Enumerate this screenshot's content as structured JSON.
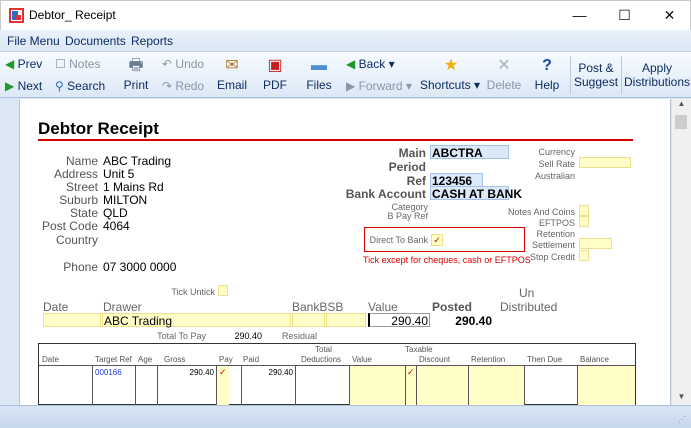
{
  "window": {
    "title": "Debtor_ Receipt",
    "controls": {
      "minimize": "—",
      "maximize": "☐",
      "close": "✕"
    }
  },
  "menu": [
    "File Menu",
    "Documents",
    "Reports"
  ],
  "toolbar": {
    "prev": "Prev",
    "next": "Next",
    "notes": "Notes",
    "search": "Search",
    "print": "Print",
    "undo": "Undo",
    "redo": "Redo",
    "email": "Email",
    "pdf": "PDF",
    "files": "Files",
    "back": "Back",
    "forward": "Forward",
    "shortcuts": "Shortcuts",
    "delete": "Delete",
    "help": "Help",
    "post_suggest_1": "Post &",
    "post_suggest_2": "Suggest",
    "apply_dist_1": "Apply",
    "apply_dist_2": "Distributions",
    "icons": {
      "prev": "green-left-arrow",
      "next": "green-right-arrow",
      "search": "magnifier",
      "print": "printer",
      "email": "envelope",
      "pdf": "pdf",
      "files": "folder",
      "back": "green-left-arrow",
      "shortcuts": "star",
      "delete": "x",
      "help": "question-mark"
    }
  },
  "form": {
    "heading": "Debtor Receipt",
    "customer": {
      "name_label": "Name",
      "name": "ABC Trading",
      "address_label": "Address",
      "address": "Unit 5",
      "street_label": "Street",
      "street": "1 Mains Rd",
      "suburb_label": "Suburb",
      "suburb": "MILTON",
      "state_label": "State",
      "state": "QLD",
      "postcode_label": "Post Code",
      "postcode": "4064",
      "country_label": "Country",
      "country": "",
      "phone_label": "Phone",
      "phone": "07 3000 0000"
    },
    "account": {
      "main_label": "Main",
      "main": "ABCTRA",
      "period_label": "Period",
      "period": "",
      "ref_label": "Ref",
      "ref": "123456",
      "bank_label": "Bank Account",
      "bank": "CASH AT BANK",
      "category_label": "Category",
      "bpay_label": "B Pay Ref",
      "direct_label": "Direct To Bank",
      "hint": "Tick except for cheques, cash or EFTPOS"
    },
    "right": {
      "currency": "Currency",
      "sell_rate": "Sell Rate",
      "australian": "Australian",
      "notes_coins": "Notes And Coins",
      "eftpos": "EFTPOS",
      "retention": "Retention",
      "settlement": "Settlement",
      "stop_credit": "Stop Credit"
    },
    "tick_untick": "Tick Untick",
    "columns": {
      "date": "Date",
      "drawer": "Drawer",
      "bank_bsb": "BankBSB",
      "value": "Value",
      "posted": "Posted",
      "un": "Un",
      "distributed": "Distributed"
    },
    "row": {
      "drawer": "ABC Trading",
      "value": "290.40",
      "posted": "290.40"
    },
    "total_to_pay_label": "Total To Pay",
    "total_to_pay": "290.40",
    "residual_label": "Residual",
    "grid": {
      "headers": {
        "date": "Date",
        "target_ref": "Target Ref",
        "age": "Age",
        "gross": "Gross",
        "pay": "Pay",
        "paid": "Paid",
        "total_deductions_1": "Total",
        "total_deductions_2": "Deductions",
        "value": "Value",
        "taxable_1": "Taxable",
        "taxable_2": "Discount",
        "retention": "Retention",
        "then_due": "Then Due",
        "balance": "Balance"
      },
      "row": {
        "target_ref": "000166",
        "gross": "290.40",
        "paid": "290.40"
      }
    }
  }
}
